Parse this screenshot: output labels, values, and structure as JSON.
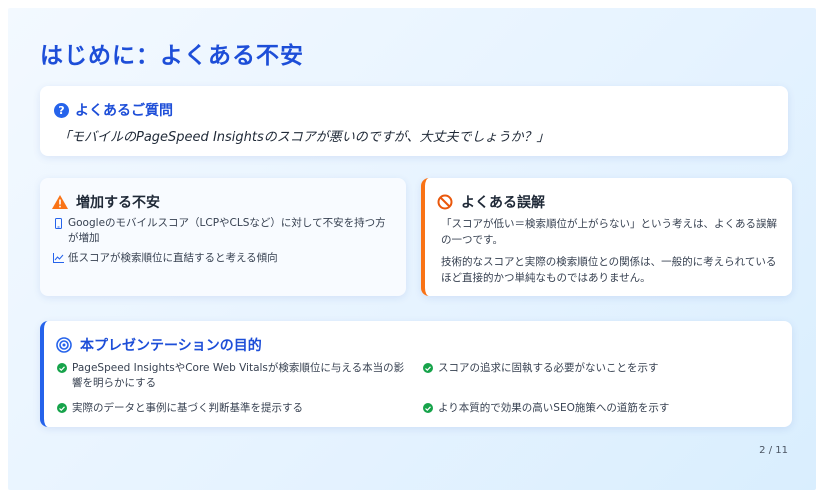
{
  "title": "はじめに：よくある不安",
  "faq": {
    "heading": "よくあるご質問",
    "icon": "question-circle-icon",
    "quote": "「モバイルのPageSpeed Insightsのスコアが悪いのですが、大丈夫でしょうか？」"
  },
  "worry": {
    "heading": "増加する不安",
    "icon": "warning-triangle-icon",
    "items": [
      {
        "icon": "mobile-phone-icon",
        "text": "Googleのモバイルスコア（LCPやCLSなど）に対して不安を持つ方が増加"
      },
      {
        "icon": "line-chart-icon",
        "text": "低スコアが検索順位に直結すると考える傾向"
      }
    ]
  },
  "misconception": {
    "heading": "よくある誤解",
    "icon": "prohibited-icon",
    "paragraphs": [
      "「スコアが低い＝検索順位が上がらない」という考えは、よくある誤解の一つです。",
      "技術的なスコアと実際の検索順位との関係は、一般的に考えられているほど直接的かつ単純なものではありません。"
    ]
  },
  "goal": {
    "heading": "本プレゼンテーションの目的",
    "icon": "target-icon",
    "items": [
      "PageSpeed InsightsやCore Web Vitalsが検索順位に与える本当の影響を明らかにする",
      "スコアの追求に固執する必要がないことを示す",
      "実際のデータと事例に基づく判断基準を提示する",
      "より本質的で効果の高いSEO施策への道筋を示す"
    ]
  },
  "page_number": "2 / 11",
  "colors": {
    "accent": "#1d4ed8",
    "warning": "#f97316",
    "success": "#16a34a"
  }
}
